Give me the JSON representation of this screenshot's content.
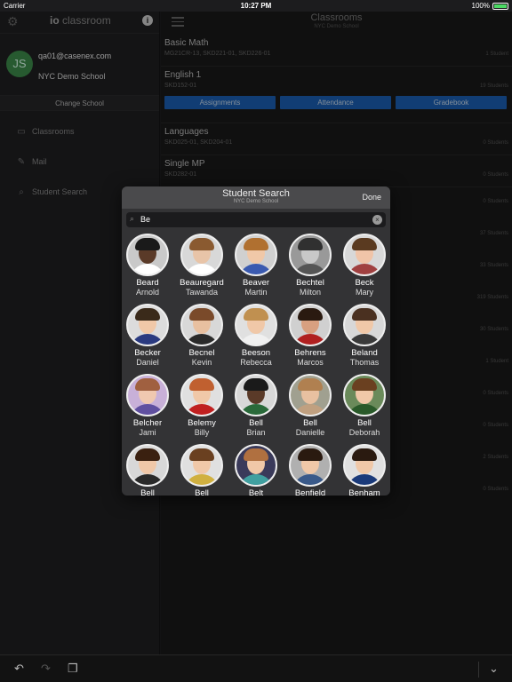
{
  "status": {
    "carrier": "Carrier",
    "time": "10:27 PM",
    "battery": "100%"
  },
  "sidebar": {
    "logo_prefix": "io",
    "logo_text": "classroom",
    "info_glyph": "i",
    "avatar_initials": "JS",
    "email": "qa01@casenex.com",
    "school": "NYC Demo School",
    "change_school": "Change School",
    "items": [
      {
        "label": "Classrooms",
        "icon": "classroom-icon"
      },
      {
        "label": "Mail",
        "icon": "mail-icon"
      },
      {
        "label": "Student Search",
        "icon": "search-icon"
      }
    ]
  },
  "main": {
    "title": "Classrooms",
    "subtitle": "NYC Demo School",
    "classes": [
      {
        "name": "Basic Math",
        "codes": "MG21CR-13, SKD221-01, SKD226-01",
        "count": "1 Student"
      },
      {
        "name": "English 1",
        "codes": "SKD152-01",
        "count": "19 Students",
        "buttons": [
          "Assignments",
          "Attendance",
          "Gradebook"
        ]
      },
      {
        "name": "Languages",
        "codes": "SKD025-01, SKD204-01",
        "count": "0 Students"
      },
      {
        "name": "Single MP",
        "codes": "SKD282-01",
        "count": "0 Students"
      }
    ],
    "extra_counts": [
      "0 Students",
      "37 Students",
      "33 Students",
      "319 Students",
      "30 Students",
      "1 Student",
      "0 Students",
      "0 Students",
      "2 Students",
      "0 Students"
    ]
  },
  "modal": {
    "title": "Student Search",
    "subtitle": "NYC Demo School",
    "done": "Done",
    "search_value": "Be",
    "students": [
      {
        "last": "Beard",
        "first": "Arnold",
        "skin": "#5a3a28",
        "hair": "#1a1a1a",
        "shirt": "#ffffff",
        "bg": "#c9c9c9"
      },
      {
        "last": "Beauregard",
        "first": "Tawanda",
        "skin": "#e8c4a8",
        "hair": "#8a5a30",
        "shirt": "#ffffff",
        "bg": "#d8d8d8"
      },
      {
        "last": "Beaver",
        "first": "Martin",
        "skin": "#f0c8a8",
        "hair": "#b07030",
        "shirt": "#3a5ab0",
        "bg": "#d0d0d0"
      },
      {
        "last": "Bechtel",
        "first": "Milton",
        "skin": "#c8c8c8",
        "hair": "#303030",
        "shirt": "#555555",
        "bg": "#999999"
      },
      {
        "last": "Beck",
        "first": "Mary",
        "skin": "#f0c4a8",
        "hair": "#5a3a20",
        "shirt": "#a04040",
        "bg": "#d8d8d8"
      },
      {
        "last": "Becker",
        "first": "Daniel",
        "skin": "#f0c8a8",
        "hair": "#3a2a1a",
        "shirt": "#2a3a80",
        "bg": "#dcdcdc"
      },
      {
        "last": "Becnel",
        "first": "Kevin",
        "skin": "#e8c0a0",
        "hair": "#7a4a2a",
        "shirt": "#2a2a2a",
        "bg": "#d8d8d8"
      },
      {
        "last": "Beeson",
        "first": "Rebecca",
        "skin": "#f0c8a8",
        "hair": "#c09050",
        "shirt": "#f0f0f0",
        "bg": "#e0e0e0"
      },
      {
        "last": "Behrens",
        "first": "Marcos",
        "skin": "#d8a080",
        "hair": "#2a1a10",
        "shirt": "#b02020",
        "bg": "#d0d0d0"
      },
      {
        "last": "Beland",
        "first": "Thomas",
        "skin": "#f0c8a8",
        "hair": "#4a3020",
        "shirt": "#3a3a3a",
        "bg": "#d8d8d8"
      },
      {
        "last": "Belcher",
        "first": "Jami",
        "skin": "#f0c8b0",
        "hair": "#a06040",
        "shirt": "#6050a0",
        "bg": "#c8b0d8"
      },
      {
        "last": "Belemy",
        "first": "Billy",
        "skin": "#f0c8a8",
        "hair": "#c06030",
        "shirt": "#c02020",
        "bg": "#e0e0e0"
      },
      {
        "last": "Bell",
        "first": "Brian",
        "skin": "#5a3a28",
        "hair": "#1a1a1a",
        "shirt": "#2a6a3a",
        "bg": "#d8d8d8"
      },
      {
        "last": "Bell",
        "first": "Danielle",
        "skin": "#e8c0a0",
        "hair": "#b08050",
        "shirt": "#c0a080",
        "bg": "#a0a090"
      },
      {
        "last": "Bell",
        "first": "Deborah",
        "skin": "#f0c8a8",
        "hair": "#6a4020",
        "shirt": "#2a5a2a",
        "bg": "#6a8a5a"
      },
      {
        "last": "Bell",
        "first": "",
        "skin": "#f0c8a8",
        "hair": "#3a2010",
        "shirt": "#2a2a2a",
        "bg": "#d8d8d8"
      },
      {
        "last": "Bell",
        "first": "",
        "skin": "#f0c8a8",
        "hair": "#6a4020",
        "shirt": "#d0b040",
        "bg": "#e0e0e0"
      },
      {
        "last": "Belt",
        "first": "",
        "skin": "#f0c8a8",
        "hair": "#b07040",
        "shirt": "#40a0a0",
        "bg": "#3a3a5a"
      },
      {
        "last": "Benfield",
        "first": "",
        "skin": "#f0c8a8",
        "hair": "#2a1a10",
        "shirt": "#3a5a8a",
        "bg": "#b0b0b0"
      },
      {
        "last": "Benham",
        "first": "",
        "skin": "#f0c8a8",
        "hair": "#2a1a10",
        "shirt": "#1a3a7a",
        "bg": "#e0e0e0"
      }
    ]
  },
  "bottom": {
    "undo": "undo-icon",
    "redo": "redo-icon",
    "copy": "copy-icon",
    "collapse": "chevron-down-icon"
  }
}
